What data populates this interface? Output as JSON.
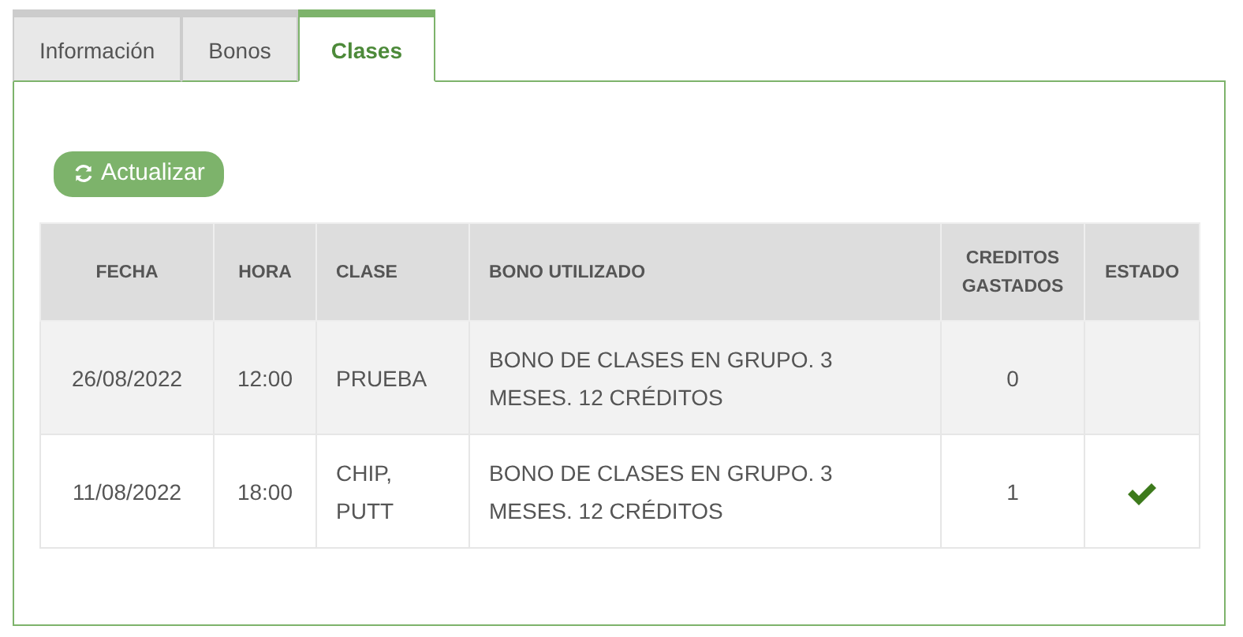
{
  "tabs": [
    {
      "label": "Información",
      "selected": false
    },
    {
      "label": "Bonos",
      "selected": false
    },
    {
      "label": "Clases",
      "selected": true
    }
  ],
  "refresh_button": {
    "label": "Actualizar"
  },
  "table": {
    "columns": [
      "FECHA",
      "HORA",
      "CLASE",
      "BONO UTILIZADO",
      "CREDITOS GASTADOS",
      "ESTADO"
    ],
    "rows": [
      {
        "fecha": "26/08/2022",
        "hora": "12:00",
        "clase": "PRUEBA",
        "bono": "BONO DE CLASES EN GRUPO. 3 MESES. 12 CRÉDITOS",
        "creditos": "0",
        "confirmed": false
      },
      {
        "fecha": "11/08/2022",
        "hora": "18:00",
        "clase": "CHIP, PUTT",
        "bono": "BONO DE CLASES EN GRUPO. 3 MESES. 12 CRÉDITOS",
        "creditos": "1",
        "confirmed": true
      }
    ]
  }
}
